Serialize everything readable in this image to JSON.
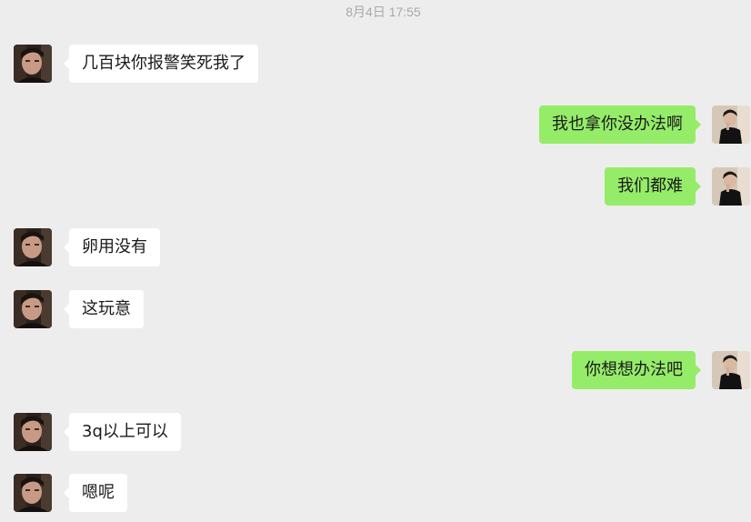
{
  "chat": {
    "timestamp": "8月4日 17:55",
    "messages": [
      {
        "side": "left",
        "text": "几百块你报警笑死我了",
        "avatar": "contact-avatar"
      },
      {
        "side": "right",
        "text": "我也拿你没办法啊",
        "avatar": "self-avatar"
      },
      {
        "side": "right",
        "text": "我们都难",
        "avatar": "self-avatar"
      },
      {
        "side": "left",
        "text": "卵用没有",
        "avatar": "contact-avatar"
      },
      {
        "side": "left",
        "text": "这玩意",
        "avatar": "contact-avatar"
      },
      {
        "side": "right",
        "text": "你想想办法吧",
        "avatar": "self-avatar"
      },
      {
        "side": "left",
        "text": "3q以上可以",
        "avatar": "contact-avatar"
      },
      {
        "side": "left",
        "text": "嗯呢",
        "avatar": "contact-avatar"
      }
    ]
  },
  "colors": {
    "background": "#ededed",
    "incoming_bubble": "#ffffff",
    "outgoing_bubble": "#95ec69",
    "timestamp_text": "#a9a9a9"
  }
}
